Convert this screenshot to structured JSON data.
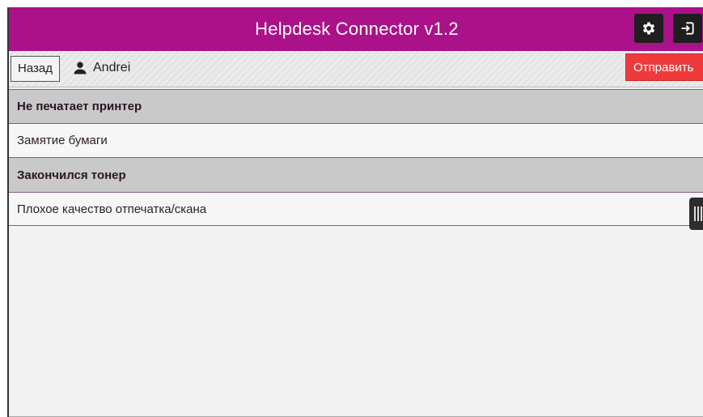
{
  "titlebar": {
    "title": "Helpdesk Connector v1.2",
    "settings_icon": "gear-icon",
    "exit_icon": "exit-icon"
  },
  "toolbar": {
    "back_label": "Назад",
    "user_icon": "user-icon",
    "user_name": "Andrei",
    "send_label": "Отправить"
  },
  "list": {
    "items": [
      {
        "label": "Не печатает принтер",
        "type": "group"
      },
      {
        "label": "Замятие бумаги",
        "type": "item"
      },
      {
        "label": "Закончился тонер",
        "type": "group"
      },
      {
        "label": "Плохое качество отпечатка/скана",
        "type": "item"
      }
    ]
  },
  "colors": {
    "titlebar": "#ab1189",
    "send_button": "#ee3a3a",
    "group_row": "#c9c9c9"
  }
}
